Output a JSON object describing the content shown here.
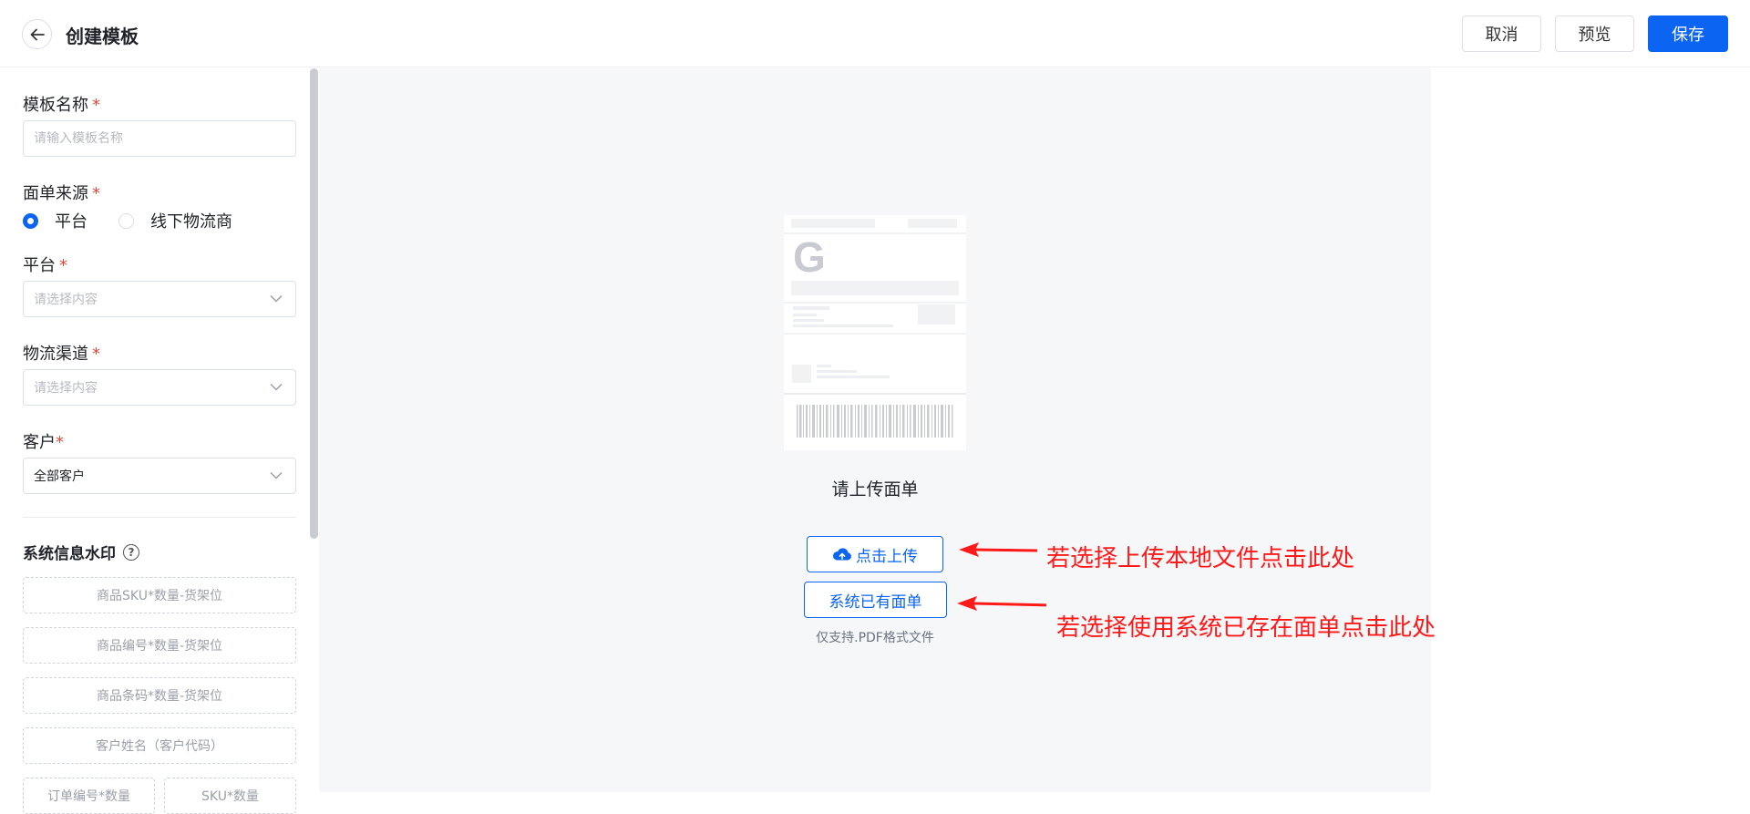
{
  "header": {
    "title": "创建模板",
    "cancel_label": "取消",
    "preview_label": "预览",
    "save_label": "保存"
  },
  "form": {
    "template_name": {
      "label": "模板名称",
      "required_mark": "*",
      "placeholder": "请输入模板名称",
      "value": ""
    },
    "source": {
      "label": "面单来源",
      "required_mark": "*",
      "options": [
        "平台",
        "线下物流商"
      ],
      "selected": "平台"
    },
    "platform": {
      "label": "平台",
      "required_mark": "*",
      "placeholder": "请选择内容"
    },
    "channel": {
      "label": "物流渠道",
      "required_mark": "*",
      "placeholder": "请选择内容"
    },
    "customer": {
      "label": "客户",
      "required_mark": "*",
      "value": "全部客户"
    }
  },
  "watermark": {
    "title": "系统信息水印",
    "help_icon": "question-circle-icon",
    "items": [
      "商品SKU*数量-货架位",
      "商品编号*数量-货架位",
      "商品条码*数量-货架位",
      "客户姓名（客户代码）",
      "订单编号*数量",
      "SKU*数量"
    ]
  },
  "preview": {
    "doc_logo": "G",
    "upload_hint": "请上传面单",
    "upload_label": "点击上传",
    "existing_label": "系统已有面单",
    "pdf_note": "仅支持.PDF格式文件"
  },
  "annotations": {
    "upload_note": "若选择上传本地文件点击此处",
    "existing_note": "若选择使用系统已存在面单点击此处",
    "arrow_color": "#ff1a1a"
  },
  "colors": {
    "primary": "#0b64f2",
    "required": "#f04438",
    "canvas_bg": "#f6f7f9"
  }
}
